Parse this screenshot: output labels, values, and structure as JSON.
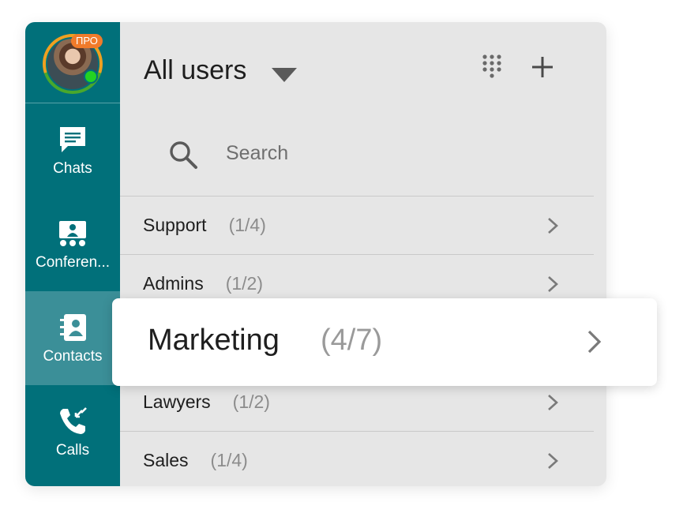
{
  "colors": {
    "sidebar": "#01707a",
    "sidebar_active": "#3b8f98",
    "main_background": "#e6e6e6",
    "pro_badge": "#f07b2b",
    "online_status": "#23d323"
  },
  "user": {
    "pro_badge": "ПРО",
    "status_icon": "online-dot"
  },
  "sidebar": {
    "items": [
      {
        "label": "Chats",
        "icon": "chat-icon",
        "active": false
      },
      {
        "label": "Conferen...",
        "icon": "conference-icon",
        "active": false
      },
      {
        "label": "Contacts",
        "icon": "contacts-icon",
        "active": true
      },
      {
        "label": "Calls",
        "icon": "calls-icon",
        "active": false
      }
    ]
  },
  "header": {
    "title": "All users",
    "dropdown_icon": "triangle-down-icon",
    "dialpad_icon": "dialpad-icon",
    "add_icon": "plus-icon"
  },
  "search": {
    "placeholder": "Search",
    "icon": "search-icon"
  },
  "groups": [
    {
      "name": "Support",
      "count": "(1/4)"
    },
    {
      "name": "Admins",
      "count": "(1/2)"
    },
    {
      "name": "Marketing",
      "count": "(4/7)",
      "highlighted": true
    },
    {
      "name": "Lawyers",
      "count": "(1/2)"
    },
    {
      "name": "Sales",
      "count": "(1/4)"
    }
  ]
}
